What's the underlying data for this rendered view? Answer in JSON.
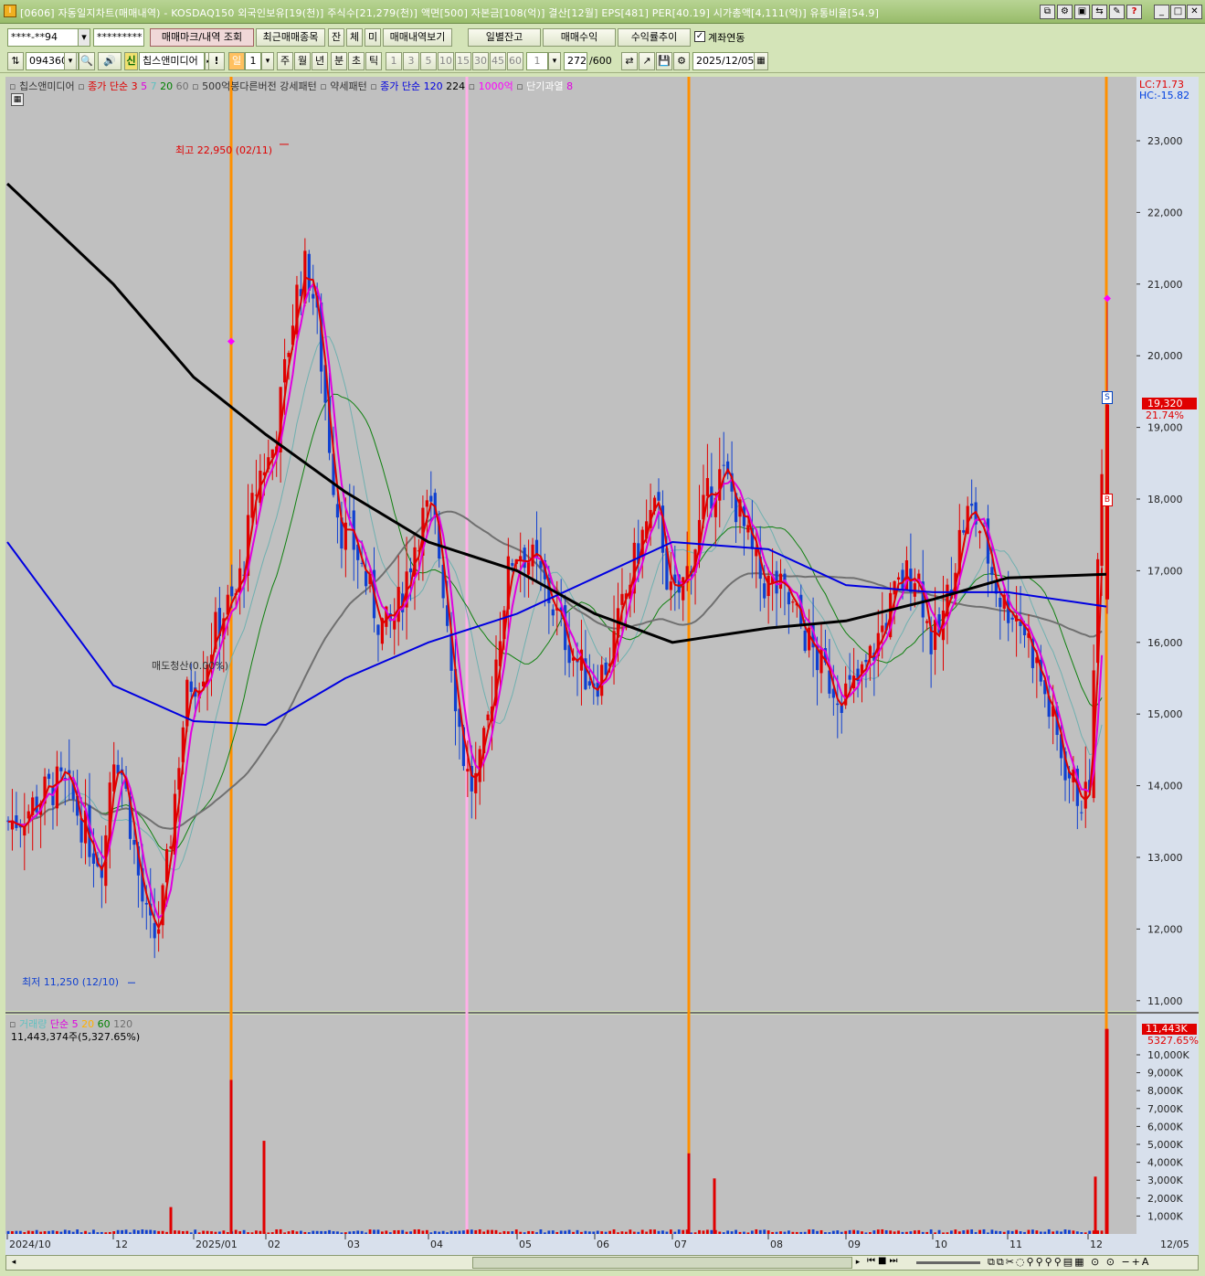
{
  "window": {
    "title": "[0606] 자동일지차트(매매내역) - KOSDAQ150 외국인보유[19(천)] 주식수[21,279(천)] 액면[500] 자본금[108(억)] 결산[12월] EPS[481] PER[40.19] 시가총액[4,111(억)] 유통비율[54.9]"
  },
  "toolbar1": {
    "account": "****-**94",
    "password": "*********",
    "tabs": [
      "매매마크/내역 조회",
      "최근매매종목",
      "잔",
      "체",
      "미",
      "매매내역보기"
    ],
    "buttons": [
      "일별잔고",
      "매매수익",
      "수익률추이"
    ],
    "checkbox_label": "계좌연동"
  },
  "toolbar2": {
    "code": "094360",
    "new_label": "신",
    "stock_name": "칩스앤미디어",
    "bang": "!",
    "period_active": "일",
    "period_num": "1",
    "periods": [
      "주",
      "월",
      "년",
      "분",
      "초",
      "틱"
    ],
    "intervals": [
      "1",
      "3",
      "5",
      "10",
      "15",
      "30",
      "45",
      "60"
    ],
    "interval_sel": "1",
    "count": "272",
    "count_max": "/600",
    "date": "2025/12/05"
  },
  "legend": {
    "name": "칩스앤미디어",
    "ma_label": "종가 단순 3",
    "ma_values": [
      "5",
      "7",
      "20",
      "60"
    ],
    "pattern": "500억봉다른버전 강세패턴",
    "pattern2": "약세패턴",
    "ma120": "종가 단순 120",
    "ma224": "224",
    "rule": "1000억",
    "overheat": "단기과열",
    "overheat_n": "8",
    "lc": "LC:71.73",
    "hc": "HC:-15.82"
  },
  "annotations": {
    "high": "최고 22,950 (02/11)",
    "low": "최저 11,250 (12/10)",
    "flat": "매도청산(0.00%)",
    "s_mark": "S",
    "b_mark": "B"
  },
  "price_axis": {
    "ticks": [
      "23,000",
      "22,000",
      "21,000",
      "20,000",
      "19,000",
      "18,000",
      "17,000",
      "16,000",
      "15,000",
      "14,000",
      "13,000",
      "12,000",
      "11,000"
    ],
    "last_price": "19,320",
    "last_pct": "21.74%"
  },
  "volume_legend": {
    "label": "거래량",
    "ma_label": "단순 5",
    "ma_values": [
      "20",
      "60",
      "120"
    ],
    "value": "11,443,374주(5,327.65%)",
    "last_volume": "11,443K",
    "last_pct": "5327.65%"
  },
  "volume_axis": {
    "ticks": [
      "10,000K",
      "9,000K",
      "8,000K",
      "7,000K",
      "6,000K",
      "5,000K",
      "4,000K",
      "3,000K",
      "2,000K",
      "1,000K"
    ]
  },
  "date_axis": {
    "labels": [
      "2024/10",
      "12",
      "2025/01",
      "02",
      "03",
      "04",
      "05",
      "06",
      "07",
      "08",
      "09",
      "10",
      "11",
      "12",
      "12/05"
    ]
  },
  "colors": {
    "chart_bg": "#c0c0c0",
    "axis_bg": "#d8e0ec",
    "up": "#e00000",
    "down": "#1040d0",
    "ma5": "#e000e0",
    "ma120": "#0000e0",
    "ma224": "#000000",
    "orange_line": "#ff9000",
    "pink_line": "#ffb0e8"
  },
  "chart_data": {
    "type": "candlestick",
    "y_range": [
      11000,
      23500
    ],
    "volume_range_k": [
      0,
      11500
    ],
    "ma120": [
      [
        "2024/10",
        17400
      ],
      [
        "2024/12",
        15400
      ],
      [
        "2025/01",
        14900
      ],
      [
        "2025/02",
        14850
      ],
      [
        "2025/03",
        15500
      ],
      [
        "2025/04",
        16000
      ],
      [
        "2025/05",
        16400
      ],
      [
        "2025/06",
        16900
      ],
      [
        "2025/07",
        17400
      ],
      [
        "2025/08",
        17300
      ],
      [
        "2025/09",
        16800
      ],
      [
        "2025/10",
        16700
      ],
      [
        "2025/11",
        16700
      ],
      [
        "2025/12/05",
        16500
      ]
    ],
    "ma224": [
      [
        "2024/10",
        22400
      ],
      [
        "2024/12",
        21000
      ],
      [
        "2025/01",
        19700
      ],
      [
        "2025/02",
        18900
      ],
      [
        "2025/03",
        18100
      ],
      [
        "2025/04",
        17400
      ],
      [
        "2025/05",
        17000
      ],
      [
        "2025/06",
        16400
      ],
      [
        "2025/07",
        16000
      ],
      [
        "2025/08",
        16200
      ],
      [
        "2025/09",
        16300
      ],
      [
        "2025/10",
        16600
      ],
      [
        "2025/11",
        16900
      ],
      [
        "2025/12/05",
        16950
      ]
    ],
    "close_path": [
      [
        "2024/10",
        13500
      ],
      [
        "2024/11",
        14000
      ],
      [
        "2024/11 late",
        13000
      ],
      [
        "2024/12",
        14500
      ],
      [
        "2024/12 mid",
        11900
      ],
      [
        "2025/01",
        15500
      ],
      [
        "2025/01 mid",
        16500
      ],
      [
        "2025/02",
        18500
      ],
      [
        "2025/02 mid",
        21200
      ],
      [
        "2025/03",
        17500
      ],
      [
        "2025/03 mid",
        16200
      ],
      [
        "2025/04",
        17800
      ],
      [
        "2025/04 mid",
        14000
      ],
      [
        "2025/05",
        17300
      ],
      [
        "2025/06",
        15500
      ],
      [
        "2025/06 late",
        17800
      ],
      [
        "2025/07",
        16600
      ],
      [
        "2025/07 mid",
        18300
      ],
      [
        "2025/08",
        16800
      ],
      [
        "2025/09",
        15300
      ],
      [
        "2025/09 late",
        17000
      ],
      [
        "2025/10",
        16000
      ],
      [
        "2025/10 mid",
        17800
      ],
      [
        "2025/11",
        16500
      ],
      [
        "2025/11 late",
        13800
      ],
      [
        "2025/12/05",
        19320
      ]
    ]
  }
}
